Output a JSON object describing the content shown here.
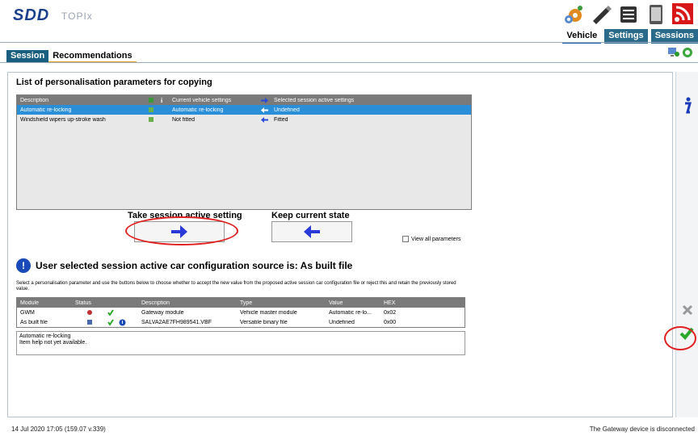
{
  "app": {
    "logo": "SDD",
    "title": "TOPIx"
  },
  "top_icons": [
    "settings-gear-icon",
    "pen-icon",
    "document-list-icon",
    "tablet-icon",
    "wifi-signal-icon"
  ],
  "top_tabs": [
    {
      "label": "Vehicle",
      "active": true
    },
    {
      "label": "Settings",
      "active": false
    },
    {
      "label": "Sessions",
      "active": false
    }
  ],
  "sub_tabs": [
    {
      "label": "Session",
      "active": true
    },
    {
      "label": "Recommendations",
      "active": false
    }
  ],
  "panel": {
    "title": "List of personalisation parameters for copying",
    "grid1": {
      "columns": [
        "Description",
        "",
        "",
        "Current vehicle settings",
        "",
        "Selected session active settings"
      ],
      "rows": [
        {
          "description": "Automatic re-locking",
          "current": "Automatic re-locking",
          "selected": "Undefined",
          "highlighted": true
        },
        {
          "description": "Windshield wipers up-stroke wash",
          "current": "Not fitted",
          "selected": "Fitted",
          "highlighted": false
        }
      ]
    },
    "take_label": "Take session active setting",
    "keep_label": "Keep current state",
    "view_all": "View all parameters",
    "source_text": "User selected session active car configuration source is: As built file",
    "instruction": "Select a personalisation parameter and use the buttons below to choose whether to accept the new value from the proposed active session car configuration file or reject this and retain the previously stored value.",
    "grid2": {
      "columns": [
        "Module",
        "Status",
        "",
        "",
        "Description",
        "Type",
        "Value",
        "HEX"
      ],
      "rows": [
        {
          "module": "GWM",
          "description": "Gateway module",
          "type": "Vehicle master module",
          "value": "Automatic re-lo...",
          "hex": "0x02"
        },
        {
          "module": "As built file",
          "description": "SALVA2AE7FH989541.VBF",
          "type": "Versatile binary file",
          "value": "Undefined",
          "hex": "0x00"
        }
      ]
    },
    "help": {
      "title": "Automatic re-locking",
      "text": "Item help not yet available."
    }
  },
  "footer": {
    "left": "14 Jul 2020 17:05 (159.07 v.339)",
    "right": "The Gateway device is disconnected"
  },
  "colors": {
    "accent": "#1a5f80",
    "selection": "#2a8fd8",
    "annotation": "#e02020",
    "check": "#2aa82a"
  }
}
